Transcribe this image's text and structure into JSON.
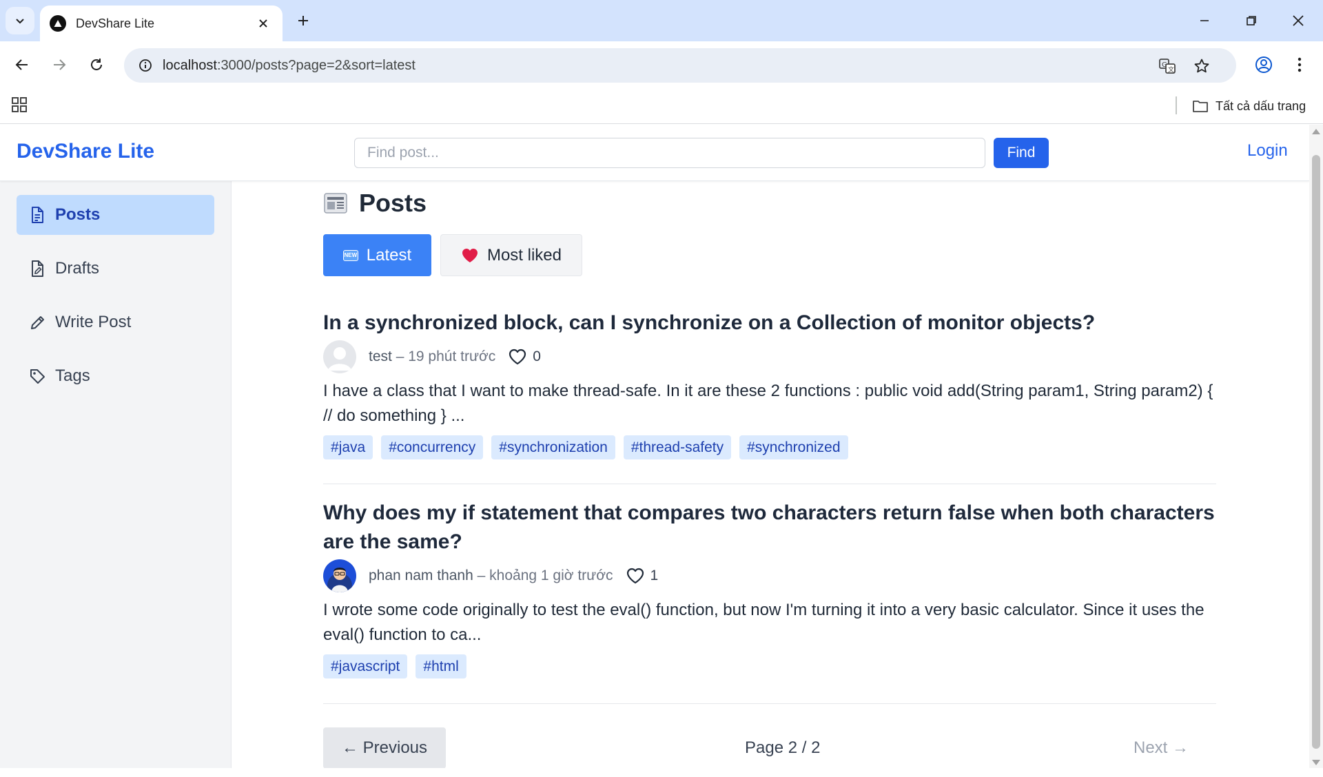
{
  "browser": {
    "tab_title": "DevShare Lite",
    "url_host": "localhost",
    "url_path": ":3000/posts?page=2&sort=latest",
    "bookmarks_all_label": "Tất cả dấu trang"
  },
  "header": {
    "brand": "DevShare Lite",
    "search_placeholder": "Find post...",
    "find_label": "Find",
    "login_label": "Login"
  },
  "sidebar": {
    "items": [
      {
        "label": "Posts",
        "icon": "document-icon",
        "active": true
      },
      {
        "label": "Drafts",
        "icon": "draft-icon",
        "active": false
      },
      {
        "label": "Write Post",
        "icon": "pencil-icon",
        "active": false
      },
      {
        "label": "Tags",
        "icon": "tag-icon",
        "active": false
      }
    ]
  },
  "main": {
    "title": "Posts",
    "sort": {
      "latest_label": "Latest",
      "liked_label": "Most liked",
      "active": "latest"
    },
    "posts": [
      {
        "title": "In a synchronized block, can I synchronize on a Collection of monitor objects?",
        "author": "test",
        "time": "19 phút trước",
        "likes": "0",
        "excerpt": "I have a class that I want to make thread-safe. In it are these 2 functions : public void add(String param1, String param2) { // do something } ...",
        "tags": [
          "#java",
          "#concurrency",
          "#synchronization",
          "#thread-safety",
          "#synchronized"
        ]
      },
      {
        "title": "Why does my if statement that compares two characters return false when both characters are the same?",
        "author": "phan nam thanh",
        "time": "khoảng 1 giờ trước",
        "likes": "1",
        "excerpt": "I wrote some code originally to test the eval() function, but now I'm turning it into a very basic calculator. Since it uses the eval() function to ca...",
        "tags": [
          "#javascript",
          "#html"
        ]
      }
    ],
    "pagination": {
      "prev_label": "← Previous",
      "page_label": "Page 2 / 2",
      "next_label": "Next →"
    }
  },
  "colors": {
    "brand": "#2563eb",
    "active_sidebar": "#bfdbfe",
    "sort_active": "#3b82f6",
    "tag_bg": "#dbeafe",
    "tag_text": "#1e40af"
  }
}
